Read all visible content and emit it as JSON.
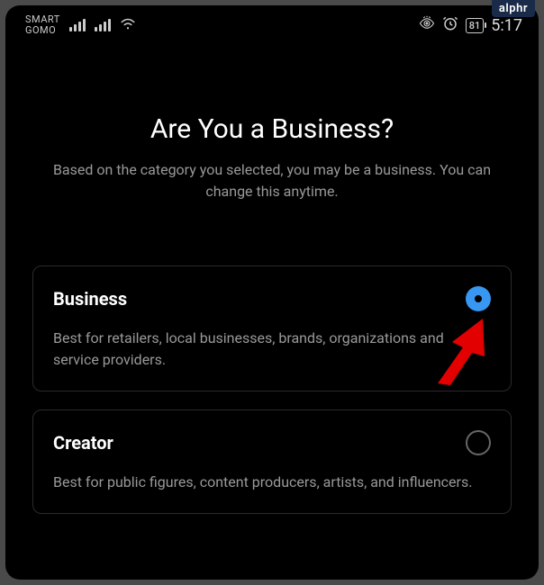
{
  "watermark": "alphr",
  "status_bar": {
    "carrier_line1": "SMART",
    "carrier_line2": "GOMO",
    "battery_level": "81",
    "time": "5:17"
  },
  "page": {
    "title": "Are You a Business?",
    "subtitle": "Based on the category you selected, you may be a business. You can change this anytime."
  },
  "options": {
    "business": {
      "title": "Business",
      "description": "Best for retailers, local businesses, brands, organizations and service providers.",
      "selected": true
    },
    "creator": {
      "title": "Creator",
      "description": "Best for public figures, content producers, artists, and influencers.",
      "selected": false
    }
  }
}
